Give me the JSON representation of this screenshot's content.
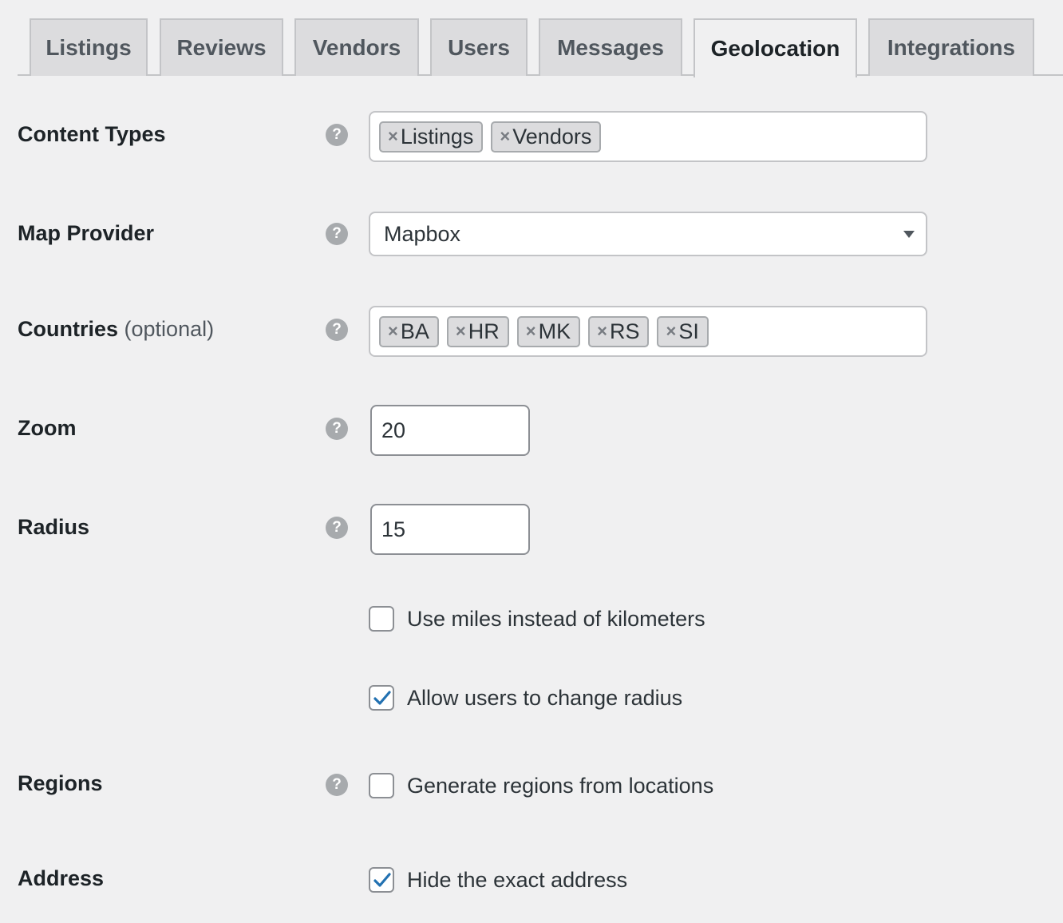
{
  "tabs": [
    {
      "label": "Listings",
      "active": false
    },
    {
      "label": "Reviews",
      "active": false
    },
    {
      "label": "Vendors",
      "active": false
    },
    {
      "label": "Users",
      "active": false
    },
    {
      "label": "Messages",
      "active": false
    },
    {
      "label": "Geolocation",
      "active": true
    },
    {
      "label": "Integrations",
      "active": false
    }
  ],
  "help_icon": "help-icon",
  "help_glyph": "?",
  "remove_glyph": "×",
  "fields": {
    "content_types": {
      "label": "Content Types",
      "tags": [
        "Listings",
        "Vendors"
      ]
    },
    "map_provider": {
      "label": "Map Provider",
      "value": "Mapbox"
    },
    "countries": {
      "label": "Countries",
      "optional": "(optional)",
      "tags": [
        "BA",
        "HR",
        "MK",
        "RS",
        "SI"
      ]
    },
    "zoom": {
      "label": "Zoom",
      "value": "20"
    },
    "radius": {
      "label": "Radius",
      "value": "15",
      "use_miles": {
        "label": "Use miles instead of kilometers",
        "checked": false
      },
      "allow_change": {
        "label": "Allow users to change radius",
        "checked": true
      }
    },
    "regions": {
      "label": "Regions",
      "generate": {
        "label": "Generate regions from locations",
        "checked": false
      }
    },
    "address": {
      "label": "Address",
      "hide_exact": {
        "label": "Hide the exact address",
        "checked": true
      }
    }
  },
  "colors": {
    "background": "#f0f0f1",
    "tab_inactive": "#dcdcde",
    "border": "#c3c4c7",
    "check_accent": "#2271b1",
    "help_icon": "#a7aaad"
  }
}
